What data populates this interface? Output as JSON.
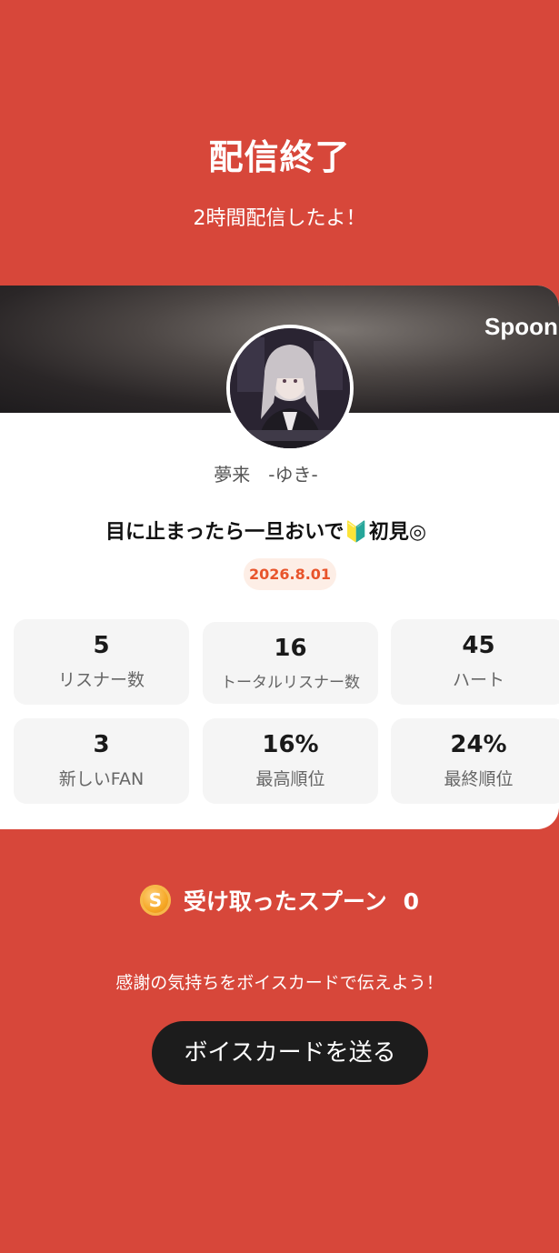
{
  "header": {
    "title": "配信終了",
    "subtitle": "2時間配信したよ！"
  },
  "card": {
    "banner_logo": "Spoon",
    "username": "夢来　-ゆき-",
    "room_title": "目に止まったら一旦おいで🔰初見◎",
    "date": "2026.8.01",
    "stats": [
      {
        "value": "5",
        "label": "リスナー数"
      },
      {
        "value": "16",
        "label": "トータルリスナー数"
      },
      {
        "value": "45",
        "label": "ハート"
      },
      {
        "value": "3",
        "label": "新しいFAN"
      },
      {
        "value": "16%",
        "label": "最高順位"
      },
      {
        "value": "24%",
        "label": "最終順位"
      }
    ]
  },
  "spoon": {
    "icon": "spoon-coin-icon",
    "coin_letter": "S",
    "label": "受け取ったスプーン",
    "count": "0"
  },
  "footer": {
    "thanks_text": "感謝の気持ちをボイスカードで伝えよう！",
    "voice_card_button": "ボイスカードを送る"
  },
  "colors": {
    "background": "#d7473a",
    "button": "#1c1c1c",
    "date_badge_bg": "#fdeee6",
    "date_badge_text": "#e8542b"
  }
}
